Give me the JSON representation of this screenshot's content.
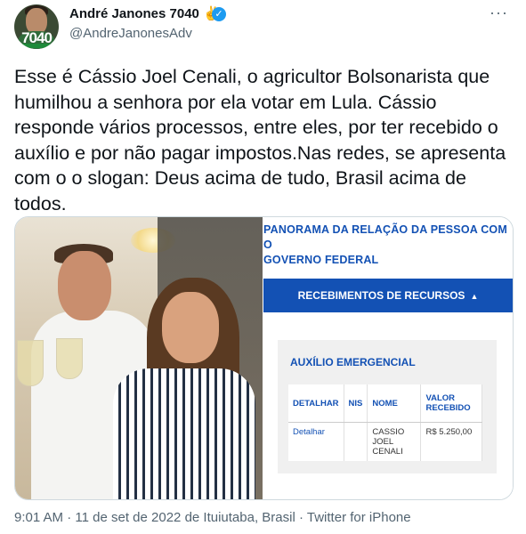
{
  "author": {
    "name": "André Janones 7040",
    "emoji": "✌️",
    "handle": "@AndreJanonesAdv",
    "avatar_text": "7040"
  },
  "more_label": "···",
  "tweet": {
    "text": "Esse é Cássio Joel Cenali, o agricultor Bolsonarista que humilhou a senhora por ela votar em Lula. Cássio responde vários processos, entre eles, por ter recebido o auxílio e por não pagar impostos.Nas redes, se apresenta com o o slogan: Deus acima de tudo, Brasil acima de todos."
  },
  "document": {
    "header_line1": "PANORAMA DA RELAÇÃO DA PESSOA COM O",
    "header_line2": "GOVERNO FEDERAL",
    "section_label": "RECEBIMENTOS DE RECURSOS",
    "caret": "▲",
    "card_title": "AUXÍLIO EMERGENCIAL",
    "columns": [
      "DETALHAR",
      "NIS",
      "NOME",
      "VALOR RECEBIDO"
    ],
    "row": {
      "detalhar": "Detalhar",
      "nis": "",
      "nome": "CASSIO JOEL CENALI",
      "valor": "R$ 5.250,00"
    }
  },
  "meta": {
    "time": "9:01 AM",
    "date": "11 de set de 2022",
    "location": "de Ituiutaba, Brasil",
    "source": "Twitter for iPhone",
    "separator": "·"
  }
}
